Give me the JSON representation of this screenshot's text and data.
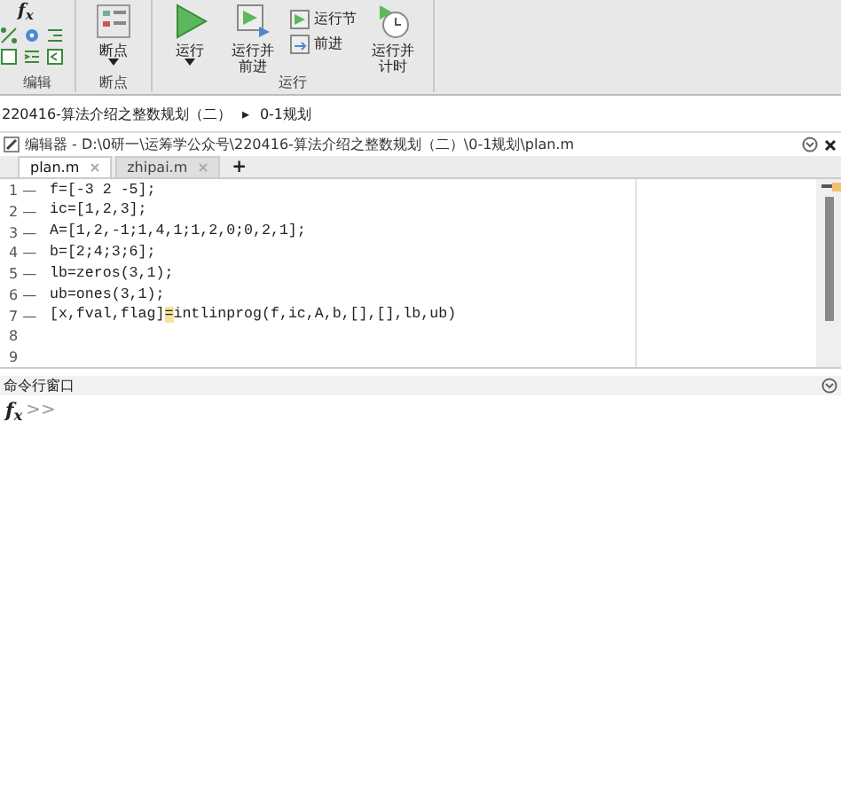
{
  "toolbar": {
    "groups": [
      {
        "label": "编辑",
        "kind": "icons",
        "fx": "f$_{x}$"
      },
      {
        "label": "断点",
        "kind": "buttons",
        "buttons": [
          {
            "label": "断点",
            "kind": "large",
            "dropdown": true
          }
        ]
      },
      {
        "label": "运行",
        "kind": "buttons",
        "buttons": [
          {
            "label": "运行",
            "kind": "large",
            "dropdown": true
          },
          {
            "label": "运行并前进",
            "kind": "large",
            "dropdown": false
          },
          {
            "label": "运行节",
            "kind": "small",
            "dropdown": false
          },
          {
            "label": "前进",
            "kind": "small",
            "dropdown": false
          },
          {
            "label": "运行并计时",
            "kind": "large",
            "dropdown": false
          }
        ]
      }
    ]
  },
  "breadcrumb": {
    "parts": [
      "220416-算法介绍之整数规划（二）",
      "0-1规划"
    ],
    "separator": "▸"
  },
  "editor": {
    "title": "编辑器 - D:\\0研一\\运筹学公众号\\220416-算法介绍之整数规划（二）\\0-1规划\\plan.m",
    "tabs": [
      {
        "label": "plan.m",
        "selected": true
      },
      {
        "label": "zhipai.m",
        "selected": false
      }
    ],
    "add_tab": "+",
    "lines": [
      {
        "number": "1",
        "marker": "—",
        "parts": [
          {
            "text": "f=[-3 2 -5];",
            "highlighted": false
          }
        ]
      },
      {
        "number": "2",
        "marker": "—",
        "parts": [
          {
            "text": "ic=[1,2,3];",
            "highlighted": false
          }
        ]
      },
      {
        "number": "3",
        "marker": "—",
        "parts": [
          {
            "text": "A=[1,2,-1;1,4,1;1,2,0;0,2,1];",
            "highlighted": false
          }
        ]
      },
      {
        "number": "4",
        "marker": "—",
        "parts": [
          {
            "text": "b=[2;4;3;6];",
            "highlighted": false
          }
        ]
      },
      {
        "number": "5",
        "marker": "—",
        "parts": [
          {
            "text": "lb=zeros(3,1);",
            "highlighted": false
          }
        ]
      },
      {
        "number": "6",
        "marker": "—",
        "parts": [
          {
            "text": "ub=ones(3,1);",
            "highlighted": false
          }
        ]
      },
      {
        "number": "7",
        "marker": "—",
        "parts": [
          {
            "text": "[x,fval,flag]",
            "highlighted": false
          },
          {
            "text": "=",
            "highlighted": true
          },
          {
            "text": "intlinprog(f,ic,A,b,[],[],lb,ub)",
            "highlighted": false
          }
        ]
      },
      {
        "number": "8"
      },
      {
        "number": "9"
      }
    ]
  },
  "command_window": {
    "title": "命令行窗口",
    "fx": "f$_{x}$",
    "prompt": ">>"
  }
}
